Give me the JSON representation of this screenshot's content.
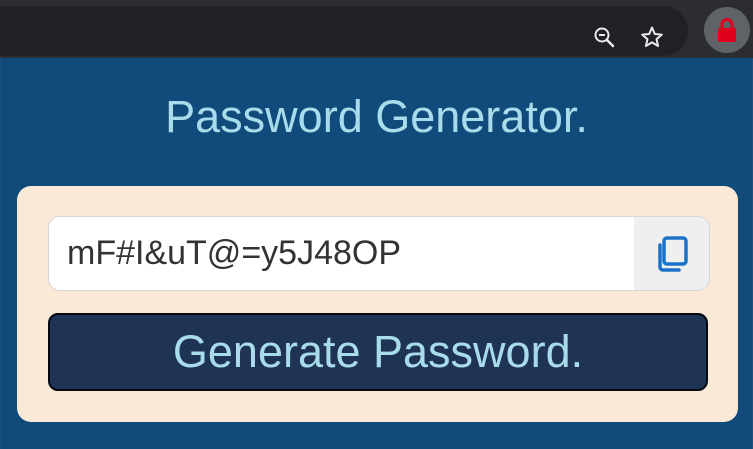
{
  "browser": {
    "icons": [
      "zoom-icon",
      "star-icon",
      "lock-extension-icon"
    ],
    "extension_color": "#e0001b"
  },
  "popup": {
    "title": "Password Generator.",
    "password_value": "mF#I&uT@=y5J48OP",
    "copy_icon": "copy-icon",
    "generate_label": "Generate Password.",
    "colors": {
      "background": "#114b7c",
      "card": "#fae9d7",
      "title_text": "#a9dceb",
      "button_bg": "#1f3454",
      "copy_icon": "#1a73c8"
    }
  }
}
